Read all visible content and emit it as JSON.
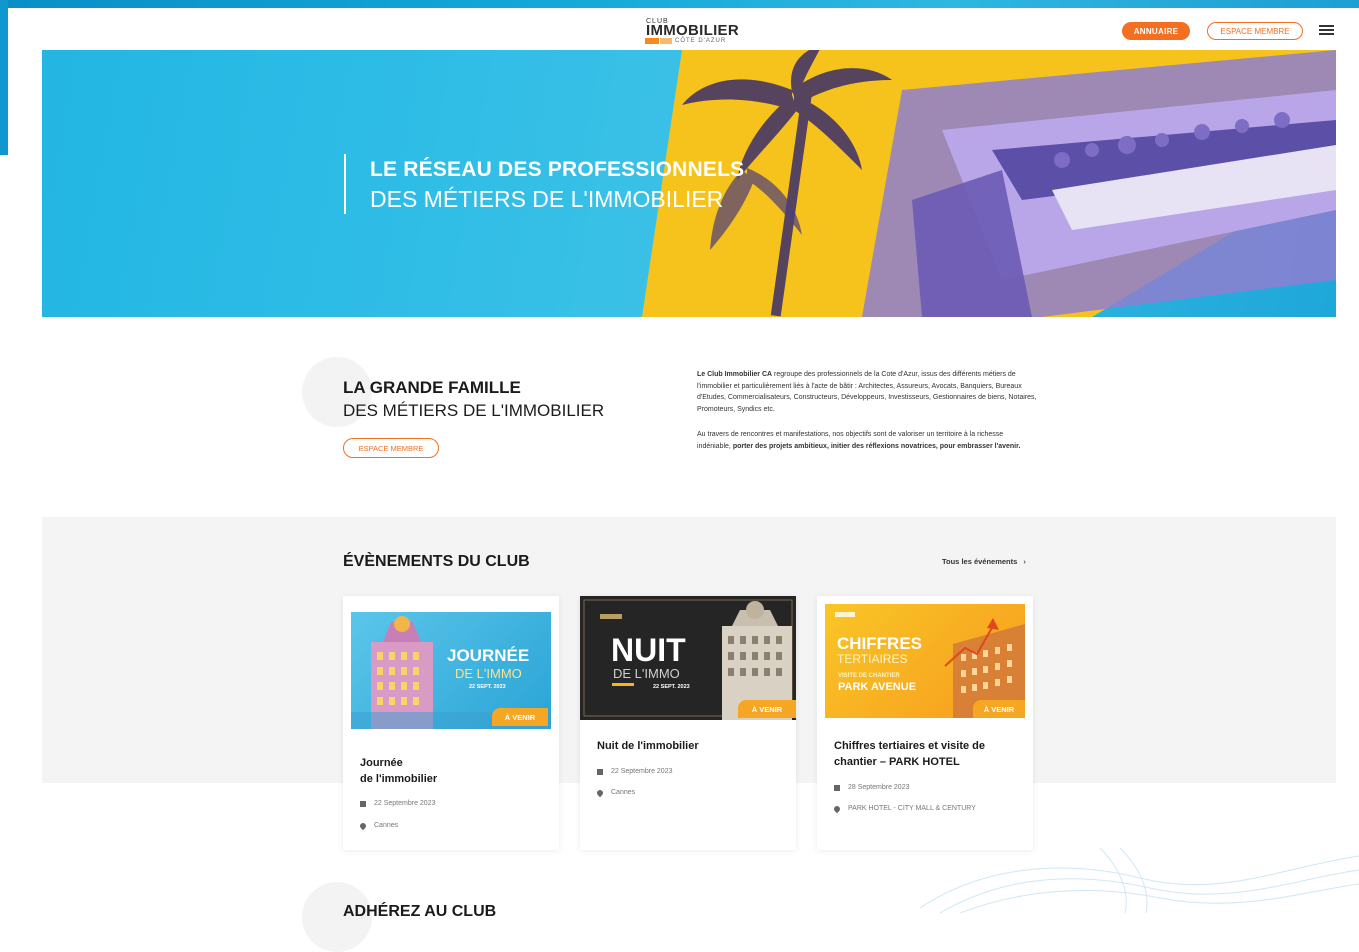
{
  "header": {
    "logo": {
      "top": "CLUB",
      "main": "IMMOBILIER",
      "sub": "CÔTE D'AZUR"
    },
    "annuaire_label": "ANNUAIRE",
    "espace_membre_label": "ESPACE MEMBRE"
  },
  "hero": {
    "line1": "LE RÉSEAU DES PROFESSIONNELS",
    "line2": "DES MÉTIERS DE L'IMMOBILIER"
  },
  "intro": {
    "title_bold": "LA GRANDE FAMILLE",
    "title_regular": "DES MÉTIERS DE L'IMMOBILIER",
    "button_label": "ESPACE MEMBRE",
    "p1_bold": "Le Club Immobilier CA",
    "p1_rest": " regroupe des professionnels de la Cote d'Azur, issus des différents métiers de l'immobilier et particulièrement liés à l'acte de bâtir : Architectes, Assureurs, Avocats, Banquiers, Bureaux d'Etudes, Commercialisateurs, Constructeurs, Développeurs, Investisseurs, Gestionnaires de biens, Notaires, Promoteurs, Syndics etc.",
    "p2_start": "Au travers de rencontres et manifestations, nos objectifs sont de valoriser un territoire à la richesse indéniable, ",
    "p2_bold": "porter des projets ambitieux, initier des réflexions novatrices, pour embrasser l'avenir."
  },
  "events": {
    "title": "ÉVÈNEMENTS DU CLUB",
    "all_link": "Tous les événements",
    "badge": "À VENIR",
    "cards": [
      {
        "title_l1": "Journée",
        "title_l2": "de l'immobilier",
        "date": "22 Septembre 2023",
        "location": "Cannes",
        "img_t1": "JOURNÉE",
        "img_t2": "DE L'IMMO",
        "img_t3": "22 SEPT. 2023"
      },
      {
        "title_l1": "Nuit de l'immobilier",
        "title_l2": "",
        "date": "22 Septembre 2023",
        "location": "Cannes",
        "img_t1": "NUIT",
        "img_t2": "DE L'IMMO",
        "img_t3": "22 SEPT. 2023"
      },
      {
        "title_l1": "Chiffres tertiaires et visite de",
        "title_l2": "chantier – PARK HOTEL",
        "date": "28 Septembre 2023",
        "location": "PARK HOTEL - CITY MALL & CENTURY",
        "img_t1": "CHIFFRES",
        "img_t2": "TERTIAIRES",
        "img_t3": "VISITE DE CHANTIER",
        "img_t4": "PARK AVENUE"
      }
    ]
  },
  "adherez": {
    "title": "ADHÉREZ AU CLUB"
  },
  "colors": {
    "accent": "#f36f21",
    "badge": "#f5a623",
    "hero": "#23b6e3"
  }
}
